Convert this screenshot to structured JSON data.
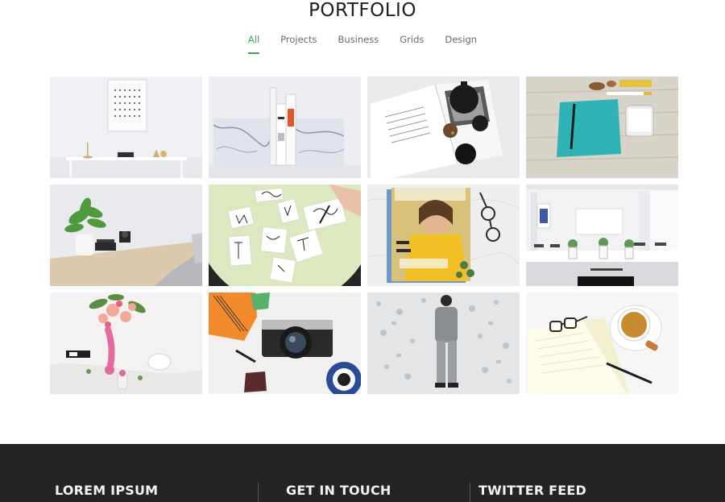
{
  "portfolio": {
    "title": "PORTFOLIO",
    "filters": [
      {
        "label": "All",
        "active": true
      },
      {
        "label": "Projects",
        "active": false
      },
      {
        "label": "Business",
        "active": false
      },
      {
        "label": "Grids",
        "active": false
      },
      {
        "label": "Design",
        "active": false
      }
    ],
    "accent_color": "#3da35d"
  },
  "gallery": {
    "items": [
      {
        "name": "white-desk-with-poster-photo"
      },
      {
        "name": "books-with-marble-bookends-photo"
      },
      {
        "name": "open-magazine-with-teapot-photo"
      },
      {
        "name": "teal-notebook-on-wood-photo"
      },
      {
        "name": "potted-plant-on-desk-photo"
      },
      {
        "name": "handwritten-cards-photo"
      },
      {
        "name": "vogue-magazine-with-glasses-photo"
      },
      {
        "name": "white-meeting-room-photo"
      },
      {
        "name": "flowers-and-glass-photo"
      },
      {
        "name": "camera-and-notebook-photo"
      },
      {
        "name": "person-at-patterned-wall-photo"
      },
      {
        "name": "notebook-glasses-and-tea-photo"
      }
    ]
  },
  "footer": {
    "background": "#242325",
    "col1_title": "LOREM IPSUM",
    "col2_title": "GET IN TOUCH",
    "col3_title": "TWITTER FEED"
  }
}
